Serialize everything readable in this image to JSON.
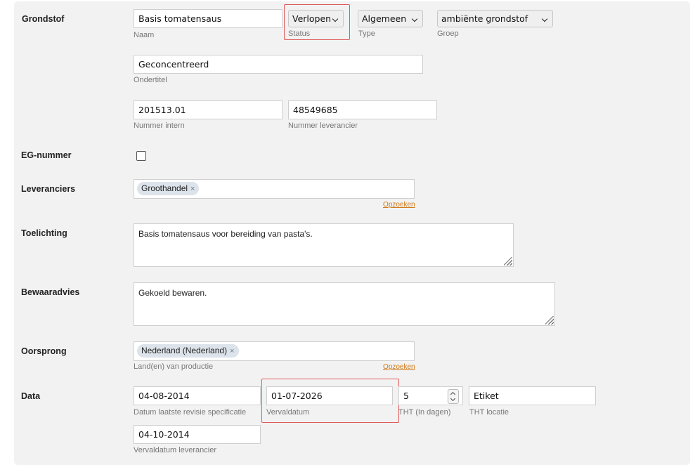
{
  "sections": {
    "grondstof": "Grondstof",
    "eg_nummer": "EG-nummer",
    "leveranciers": "Leveranciers",
    "toelichting": "Toelichting",
    "bewaaradvies": "Bewaaradvies",
    "oorsprong": "Oorsprong",
    "data": "Data"
  },
  "grondstof": {
    "naam": {
      "value": "Basis tomatensaus",
      "label": "Naam"
    },
    "status": {
      "value": "Verlopen",
      "label": "Status"
    },
    "type": {
      "value": "Algemeen",
      "label": "Type"
    },
    "groep": {
      "value": "ambiënte grondstof",
      "label": "Groep"
    },
    "ondertitel": {
      "value": "Geconcentreerd",
      "label": "Ondertitel"
    },
    "nummer_intern": {
      "value": "201513.01",
      "label": "Nummer intern"
    },
    "nummer_leverancier": {
      "value": "48549685",
      "label": "Nummer leverancier"
    }
  },
  "eg_nummer": {
    "checked": false
  },
  "leveranciers": {
    "tags": [
      {
        "label": "Groothandel"
      }
    ],
    "search_link": "Opzoeken"
  },
  "toelichting": {
    "value": "Basis tomatensaus voor bereiding van pasta's."
  },
  "bewaaradvies": {
    "value": "Gekoeld bewaren."
  },
  "oorsprong": {
    "tags": [
      {
        "label": "Nederland (Nederland)"
      }
    ],
    "label": "Land(en) van productie",
    "search_link": "Opzoeken"
  },
  "data": {
    "revisie": {
      "value": "04-08-2014",
      "label": "Datum laatste revisie specificatie"
    },
    "vervaldatum": {
      "value": "01-07-2026",
      "label": "Vervaldatum"
    },
    "tht": {
      "value": "5",
      "label": "THT (In dagen)"
    },
    "tht_locatie": {
      "value": "Etiket",
      "label": "THT locatie"
    },
    "vervaldatum_leverancier": {
      "value": "04-10-2014",
      "label": "Vervaldatum leverancier"
    }
  },
  "tag_remove_symbol": "×",
  "colors": {
    "highlight": "#e05a5a",
    "link": "#d07a18",
    "tag_bg": "#dde3ea"
  }
}
